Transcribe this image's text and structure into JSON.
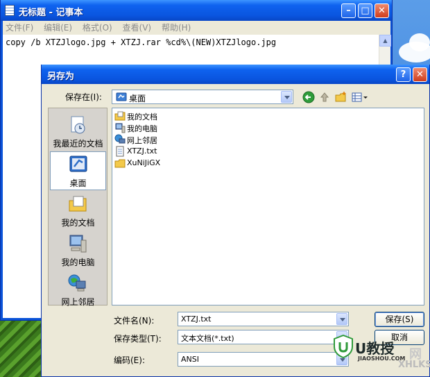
{
  "notepad": {
    "title": "无标题 - 记事本",
    "menu": [
      "文件(F)",
      "编辑(E)",
      "格式(O)",
      "查看(V)",
      "帮助(H)"
    ],
    "content": "copy /b XTZJlogo.jpg + XTZJ.rar %cd%\\(NEW)XTZJlogo.jpg"
  },
  "dialog": {
    "title": "另存为",
    "save_in_label": "保存在(I):",
    "save_in_value": "桌面",
    "places": [
      "我最近的文档",
      "桌面",
      "我的文档",
      "我的电脑",
      "网上邻居"
    ],
    "selected_place": "桌面",
    "files": [
      {
        "name": "我的文档",
        "icon": "folder-documents-icon"
      },
      {
        "name": "我的电脑",
        "icon": "computer-icon"
      },
      {
        "name": "网上邻居",
        "icon": "network-icon"
      },
      {
        "name": "XTZJ.txt",
        "icon": "text-file-icon"
      },
      {
        "name": "XuNiJiGX",
        "icon": "folder-icon"
      }
    ],
    "filename_label": "文件名(N):",
    "filename_value": "XTZJ.txt",
    "filetype_label": "保存类型(T):",
    "filetype_value": "文本文档(*.txt)",
    "encoding_label": "编码(E):",
    "encoding_value": "ANSI",
    "save_button": "保存(S)",
    "cancel_button": "取消"
  },
  "watermark": {
    "brand": "U教授",
    "site_small": "JIAOSHOU.COM",
    "site_big": "XHLKS.CN",
    "corner": "网"
  },
  "colors": {
    "title_blue": "#0a55df",
    "dialog_face": "#ece9d8",
    "close_red": "#cf3d1d"
  }
}
